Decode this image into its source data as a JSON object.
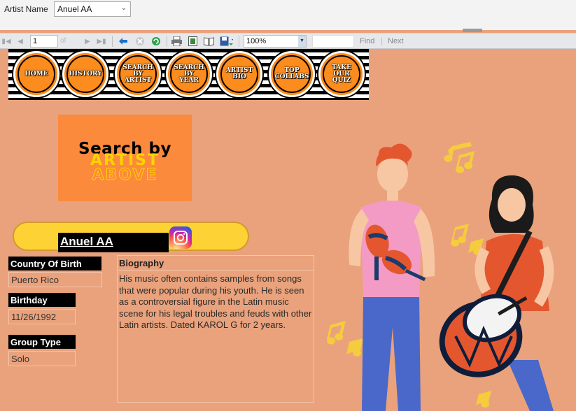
{
  "parameters": {
    "artist_label": "Artist Name",
    "artist_value": "Anuel AA"
  },
  "toolbar": {
    "page": "1",
    "of": "of",
    "zoom": "100%",
    "find": "Find",
    "find_sep": "|",
    "next": "Next"
  },
  "nav_buttons": [
    "HOME",
    "HISTORY",
    "SEARCH\nBY\nARTIST",
    "SEARCH\nBY\nYEAR",
    "ARTIST\nBIO",
    "TOP\nCOLLABS",
    "TAKE\nOUR\nQUIZ"
  ],
  "search_banner": {
    "line1": "Search by",
    "line2": "ARTIST",
    "line3": "ABOVE"
  },
  "artist": {
    "name": "Anuel AA",
    "country_label": "Country Of Birth",
    "country": "Puerto Rico",
    "birthday_label": "Birthday",
    "birthday": "11/26/1992",
    "group_type_label": "Group Type",
    "group_type": "Solo",
    "biography_label": "Biography",
    "biography": "His music often contains samples from songs that were popular during his youth. He is seen as a controversial figure in the Latin music scene for his legal troubles and feuds with other Latin artists. Dated KAROL G for 2 years."
  },
  "colors": {
    "background": "#e9a27c",
    "nav_orange": "#fb8c1d",
    "pill_yellow": "#fcd235",
    "search_box": "#fc8a3c"
  }
}
